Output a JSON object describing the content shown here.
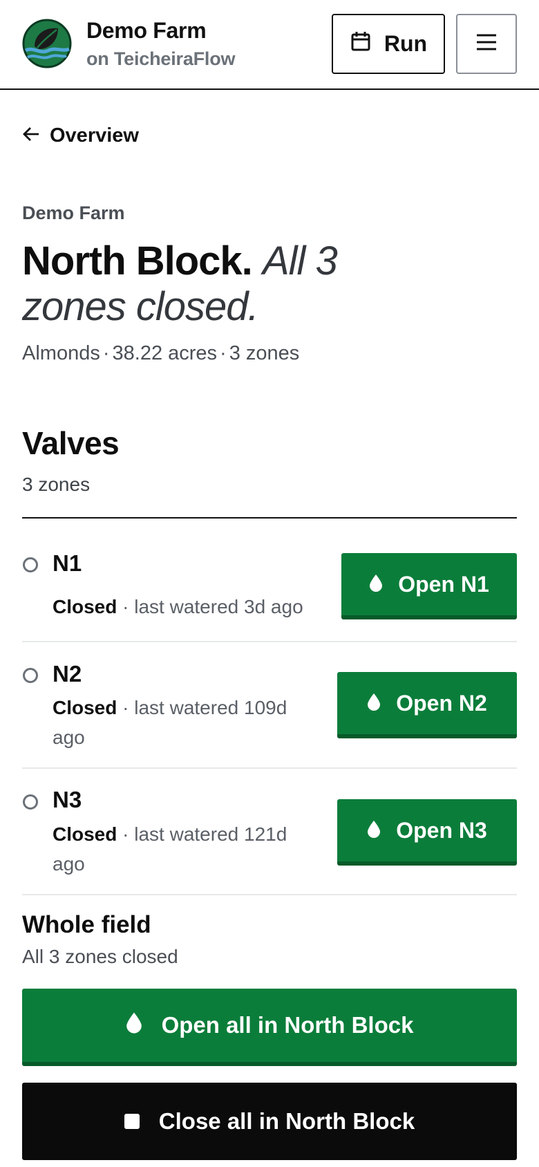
{
  "header": {
    "brand_name": "Demo Farm",
    "brand_sub": "on TeicheiraFlow",
    "run_label": "Run",
    "icons": {
      "logo": "leaf-water-logo",
      "run": "calendar-icon",
      "menu": "hamburger-menu-icon"
    }
  },
  "nav": {
    "back_label": "Overview",
    "back_icon": "arrow-left-icon"
  },
  "page": {
    "breadcrumb": "Demo Farm",
    "title_strong": "North Block.",
    "title_italic": "All 3 zones closed.",
    "meta": {
      "crop": "Almonds",
      "acreage": "38.22 acres",
      "zones": "3 zones"
    }
  },
  "valves": {
    "title": "Valves",
    "subtitle": "3 zones",
    "zones": [
      {
        "name": "N1",
        "state": "Closed",
        "detail": "last watered 3d ago",
        "button": "Open N1"
      },
      {
        "name": "N2",
        "state": "Closed",
        "detail": "last watered 109d ago",
        "button": "Open N2"
      },
      {
        "name": "N3",
        "state": "Closed",
        "detail": "last watered 121d ago",
        "button": "Open N3"
      }
    ]
  },
  "whole_field": {
    "title": "Whole field",
    "subtitle": "All 3 zones closed",
    "open_all_label": "Open all in North Block",
    "close_all_label": "Close all in North Block"
  },
  "colors": {
    "primary_green": "#0b7d3a",
    "primary_green_dark": "#075a29",
    "black_button": "#0b0b0b",
    "muted_text": "#4a4f55",
    "status_dot": "#6b7178"
  }
}
